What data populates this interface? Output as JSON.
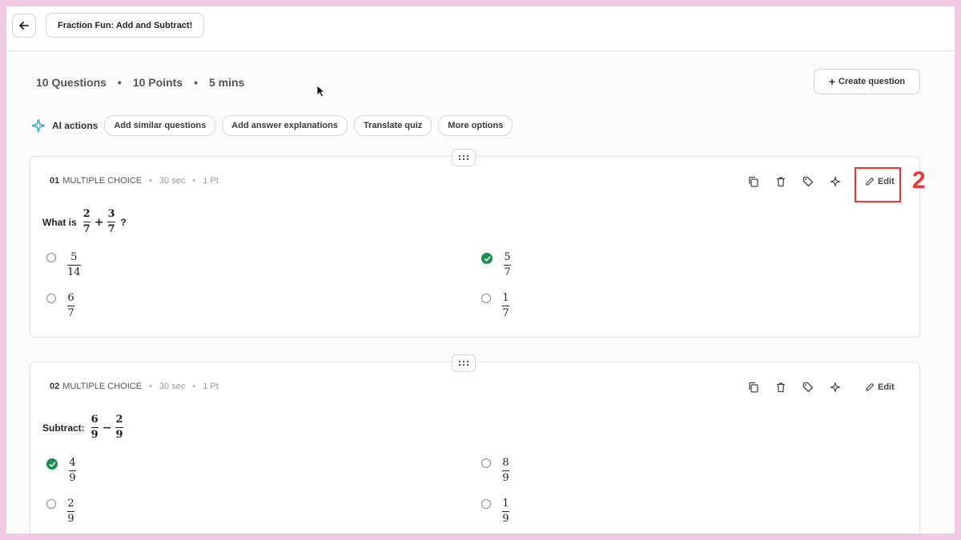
{
  "header": {
    "title": "Fraction Fun: Add and Subtract!"
  },
  "summary": {
    "questions": "10 Questions",
    "points": "10 Points",
    "duration": "5 mins"
  },
  "create_label": "Create question",
  "ai": {
    "label": "AI actions",
    "chips": [
      "Add similar questions",
      "Add answer explanations",
      "Translate quiz",
      "More options"
    ]
  },
  "edit_label": "Edit",
  "annotation": {
    "step": "2",
    "color": "#e53935"
  },
  "colors": {
    "correct": "#1e8e4f",
    "background": "#f0c8e2"
  },
  "questions": [
    {
      "number": "01",
      "type": "MULTIPLE CHOICE",
      "time": "30 sec",
      "points": "1 Pt",
      "prompt": "What is",
      "expr": {
        "a_num": "2",
        "a_den": "7",
        "op": "+",
        "b_num": "3",
        "b_den": "7",
        "end": "?"
      },
      "options": [
        {
          "num": "5",
          "den": "14",
          "correct": false
        },
        {
          "num": "5",
          "den": "7",
          "correct": true
        },
        {
          "num": "6",
          "den": "7",
          "correct": false
        },
        {
          "num": "1",
          "den": "7",
          "correct": false
        }
      ]
    },
    {
      "number": "02",
      "type": "MULTIPLE CHOICE",
      "time": "30 sec",
      "points": "1 Pt",
      "prompt": "Subtract:",
      "expr": {
        "a_num": "6",
        "a_den": "9",
        "op": "−",
        "b_num": "2",
        "b_den": "9",
        "end": ""
      },
      "options": [
        {
          "num": "4",
          "den": "9",
          "correct": true
        },
        {
          "num": "8",
          "den": "9",
          "correct": false
        },
        {
          "num": "2",
          "den": "9",
          "correct": false
        },
        {
          "num": "1",
          "den": "9",
          "correct": false
        }
      ]
    }
  ]
}
